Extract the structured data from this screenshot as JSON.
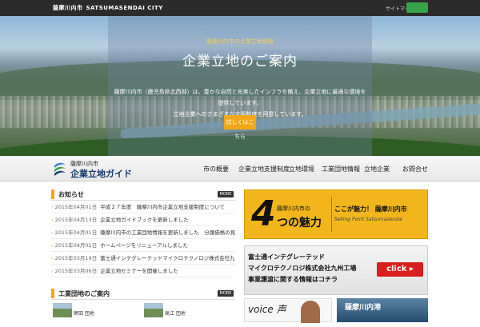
{
  "topbar": {
    "city_jp": "薩摩川内市",
    "city_en": "SATSUMASENDAI CITY",
    "lang_link": "サイトマップ"
  },
  "hero": {
    "subtitle": "薩摩川内市の企業立地情報",
    "title": "企業立地のご案内",
    "description_line1": "薩摩川内市（鹿児島県北西部）は、豊かな自然と充実したインフラを備え、企業立地に最適な環境を提供しています。",
    "description_line2": "立地企業へのさまざまな支援制度を用意しています。",
    "button": "詳しくはこちら"
  },
  "logo": {
    "line1": "薩摩川内市",
    "line2": "企業立地ガイド"
  },
  "nav": {
    "items": [
      "市の概要",
      "企業立地支援制度",
      "立地環境",
      "工業団地情報",
      "立地企業",
      "お問合せ"
    ]
  },
  "news": {
    "heading": "お知らせ",
    "more": "MORE",
    "items": [
      {
        "date": "2015年04月01日",
        "title": "平成２７年度　薩摩川内市企業立地支援制度について"
      },
      {
        "date": "2015年04月13日",
        "title": "企業立地ガイドブックを更新しました"
      },
      {
        "date": "2015年04月01日",
        "title": "薩摩川内市の工業団地情報を更新しました　分譲価格の見直しについて"
      },
      {
        "date": "2015年04月01日",
        "title": "ホームページをリニューアルしました"
      },
      {
        "date": "2015年03月19日",
        "title": "富士通インテグレーテッドマイクロテクノロジ株式会社九州工場事業譲渡に関する情報について"
      },
      {
        "date": "2015年03月06日",
        "title": "企業立地セミナーを開催しました"
      }
    ]
  },
  "industrial": {
    "heading": "工業団地のご案内",
    "more": "MORE",
    "items": [
      {
        "label": "寄田 団地"
      },
      {
        "label": "高江 団地"
      }
    ]
  },
  "banners": {
    "four": {
      "num": "4",
      "jp1": "薩摩川内市の",
      "jp2": "つの魅力",
      "right1": "ここが魅力！ 薩摩川内市",
      "right2": "Selling Point Satsumasendai"
    },
    "fujitsu": {
      "line1": "富士通インテグレーテッド",
      "line2": "マイクロテクノロジ株式会社九州工場",
      "line3": "事業譲渡に関する情報はコチラ",
      "click": "click ▸"
    },
    "voice": {
      "text": "voice 声"
    },
    "port": {
      "text": "薩摩川内港"
    }
  },
  "colors": {
    "accent": "#f2a81a",
    "topbar": "#2b2b2b",
    "green": "#39a34a",
    "click_red": "#d81e1e"
  }
}
